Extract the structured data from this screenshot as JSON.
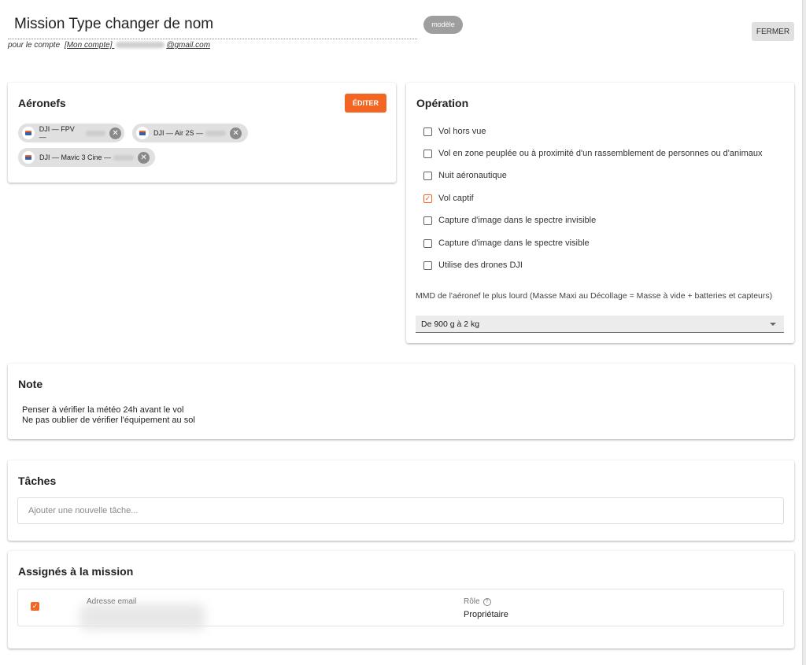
{
  "header": {
    "title": "Mission Type changer de nom",
    "account_prefix": "pour le compte",
    "account_link": "[Mon compte]",
    "account_email_suffix": "@gmail.com",
    "template_badge": "modèle",
    "close_label": "FERMER"
  },
  "aircraft": {
    "title": "Aéronefs",
    "edit_label": "ÉDITER",
    "chips": [
      {
        "label": "DJI — FPV —"
      },
      {
        "label": "DJI — Air 2S —"
      },
      {
        "label": "DJI — Mavic 3 Cine —"
      }
    ],
    "remove_icon": "close-circle-icon",
    "drone_icon": "drone-icon"
  },
  "operation": {
    "title": "Opération",
    "options": [
      {
        "label": "Vol hors vue",
        "checked": false
      },
      {
        "label": "Vol en zone peuplée ou à proximité d'un rassemblement de personnes ou d'animaux",
        "checked": false
      },
      {
        "label": "Nuit aéronautique",
        "checked": false
      },
      {
        "label": "Vol captif",
        "checked": true
      },
      {
        "label": "Capture d'image dans le spectre invisible",
        "checked": false
      },
      {
        "label": "Capture d'image dans le spectre visible",
        "checked": false
      },
      {
        "label": "Utilise des drones DJI",
        "checked": false
      }
    ],
    "mmd_label": "MMD de l'aéronef le plus lourd (Masse Maxi au Décollage = Masse à vide + batteries et capteurs)",
    "mmd_value": "De 900 g à 2 kg"
  },
  "note": {
    "title": "Note",
    "lines": [
      "Penser à vérifier la météo 24h avant le vol",
      "Ne pas oublier de vérifier l'équipement au sol"
    ]
  },
  "tasks": {
    "title": "Tâches",
    "placeholder": "Ajouter une nouvelle tâche..."
  },
  "assigned": {
    "title": "Assignés à la mission",
    "email_header": "Adresse email",
    "role_header": "Rôle",
    "role_value": "Propriétaire",
    "selected": true
  },
  "colors": {
    "accent": "#f26522",
    "badge": "#9e9e9e",
    "chip": "#e0e0e0"
  }
}
